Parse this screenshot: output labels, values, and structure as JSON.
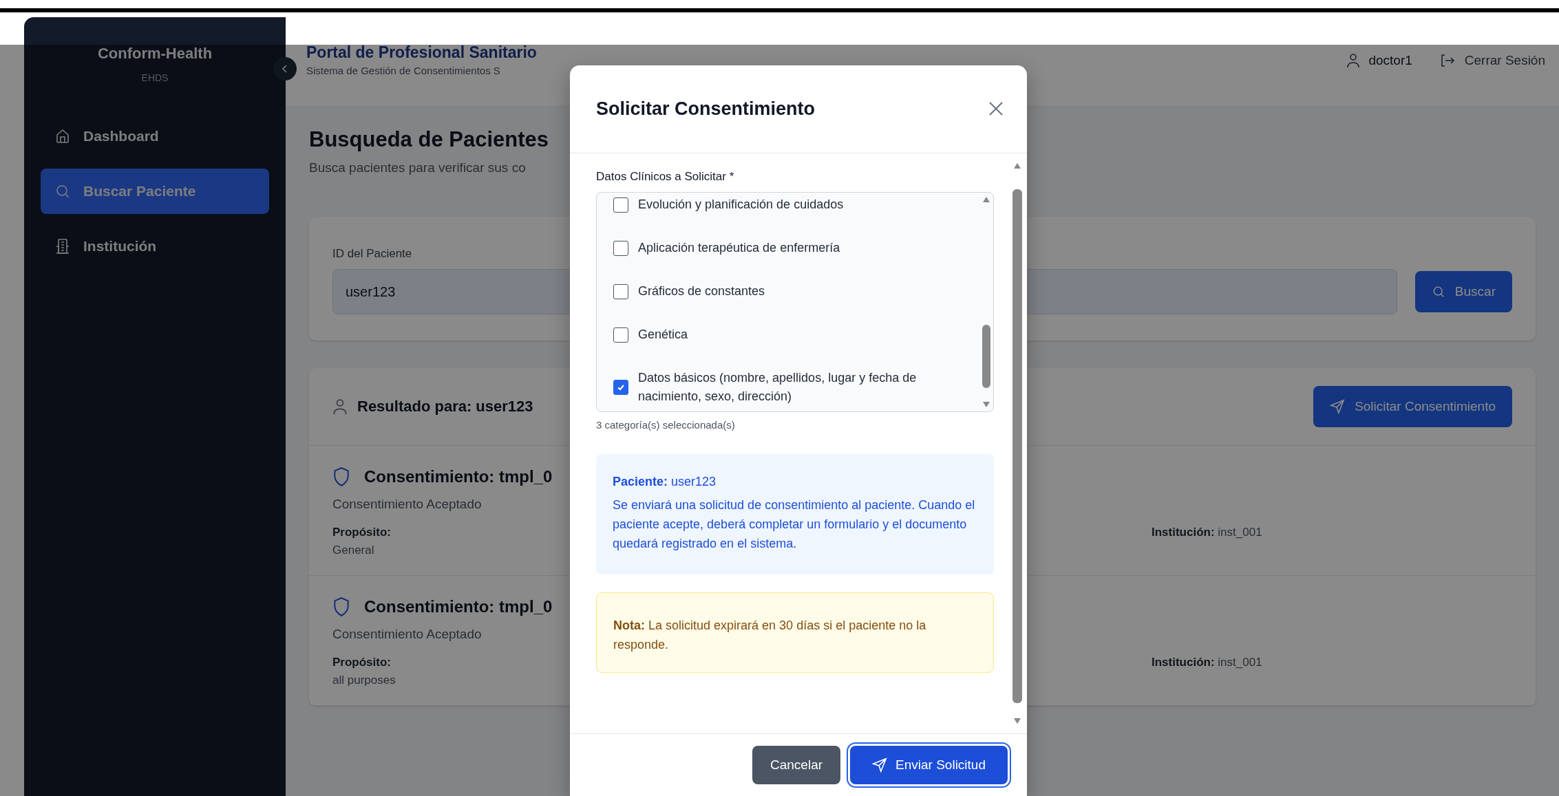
{
  "sidebar": {
    "brand": "Conform-Health",
    "subtitle": "EHDS",
    "items": [
      {
        "label": "Dashboard",
        "kind": "home",
        "selected": false
      },
      {
        "label": "Buscar Paciente",
        "kind": "search",
        "selected": true
      },
      {
        "label": "Institución",
        "kind": "building",
        "selected": false
      }
    ]
  },
  "header": {
    "title": "Portal de Profesional Sanitario",
    "subtitle": "Sistema de Gestión de Consentimientos S",
    "user": "doctor1",
    "logout": "Cerrar Sesión"
  },
  "page": {
    "title": "Busqueda de Pacientes",
    "subtitle": "Busca pacientes para verificar sus co"
  },
  "search": {
    "label": "ID del Paciente",
    "value": "user123",
    "button": "Buscar"
  },
  "results": {
    "title": "Resultado para: user123",
    "button": "Solicitar Consentimiento",
    "consents": [
      {
        "title": "Consentimiento: tmpl_0",
        "status": "Consentimiento Aceptado",
        "purpose_label": "Propósito:",
        "purpose": "General",
        "institution": "**Institución:** inst_001"
      },
      {
        "title": "Consentimiento: tmpl_0",
        "status": "Consentimiento Aceptado",
        "purpose_label": "Propósito:",
        "purpose": "all purposes",
        "institution": "**Institución:** inst_001"
      }
    ]
  },
  "modal": {
    "title": "Solicitar Consentimiento",
    "field_label": "Datos Clínicos a Solicitar *",
    "options": [
      {
        "label": "Evolución y planificación de cuidados",
        "checked": false
      },
      {
        "label": "Aplicación terapéutica de enfermería",
        "checked": false
      },
      {
        "label": "Gráficos de constantes",
        "checked": false
      },
      {
        "label": "Genética",
        "checked": false
      },
      {
        "label": "Datos básicos (nombre, apellidos, lugar y fecha de nacimiento, sexo, dirección)",
        "checked": true
      }
    ],
    "count": "3 categoría(s) seleccionada(s)",
    "patient": "**Paciente:** user123",
    "info": "Se enviará una solicitud de consentimiento al paciente. Cuando el paciente acepte, deberá completar un formulario y el documento quedará registrado en el sistema.",
    "note": "**Nota:** La solicitud expirará en 30 días si el paciente no la responde.",
    "cancel": "Cancelar",
    "submit": "Enviar Solicitud"
  }
}
